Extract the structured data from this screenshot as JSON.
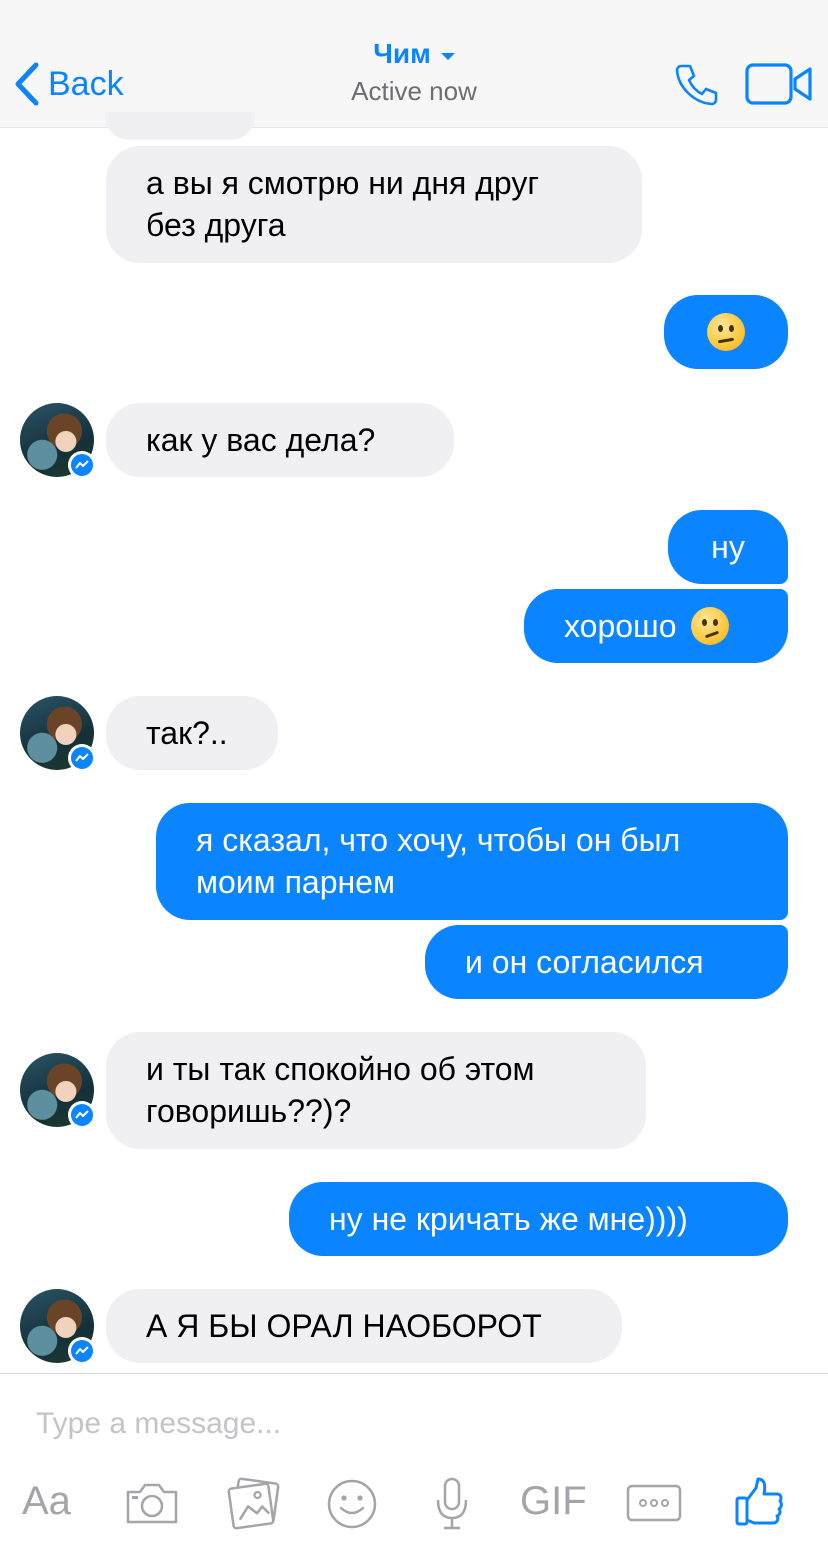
{
  "header": {
    "back_label": "Back",
    "contact_name": "Чим",
    "status": "Active now"
  },
  "messages": [
    {
      "from": "contact",
      "text_lines": [
        "а вы я смотрю ни дня друг",
        "без друга"
      ]
    },
    {
      "from": "me",
      "emoji": "confused-face"
    },
    {
      "from": "contact",
      "text_lines": [
        "как у вас дела?"
      ]
    },
    {
      "from": "me",
      "text_lines": [
        "ну"
      ]
    },
    {
      "from": "me",
      "text_lines": [
        "хорошо"
      ],
      "emoji": "smirking-face"
    },
    {
      "from": "contact",
      "text_lines": [
        "так?.."
      ]
    },
    {
      "from": "me",
      "text_lines": [
        "я сказал, что хочу, чтобы он был",
        "моим парнем"
      ]
    },
    {
      "from": "me",
      "text_lines": [
        "и он согласился"
      ]
    },
    {
      "from": "contact",
      "text_lines": [
        "и ты так спокойно об этом",
        "говоришь??)?"
      ]
    },
    {
      "from": "me",
      "text_lines": [
        "ну не кричать же мне))))"
      ]
    },
    {
      "from": "contact",
      "text_lines": [
        "А Я БЫ ОРАЛ НАОБОРОТ"
      ]
    }
  ],
  "composer": {
    "placeholder": "Type a message...",
    "tools": [
      {
        "icon": "text-format-icon",
        "label": "Aa"
      },
      {
        "icon": "camera-icon"
      },
      {
        "icon": "photo-gallery-icon"
      },
      {
        "icon": "emoji-icon"
      },
      {
        "icon": "microphone-icon"
      },
      {
        "icon": "gif-icon",
        "label": "GIF"
      },
      {
        "icon": "more-icon"
      },
      {
        "icon": "thumbs-up-icon"
      }
    ]
  },
  "colors": {
    "accent": "#0a84ff",
    "incoming_bubble": "#f0f0f3",
    "outgoing_bubble": "#0a84ff",
    "header_bg": "#f7f7f8"
  }
}
